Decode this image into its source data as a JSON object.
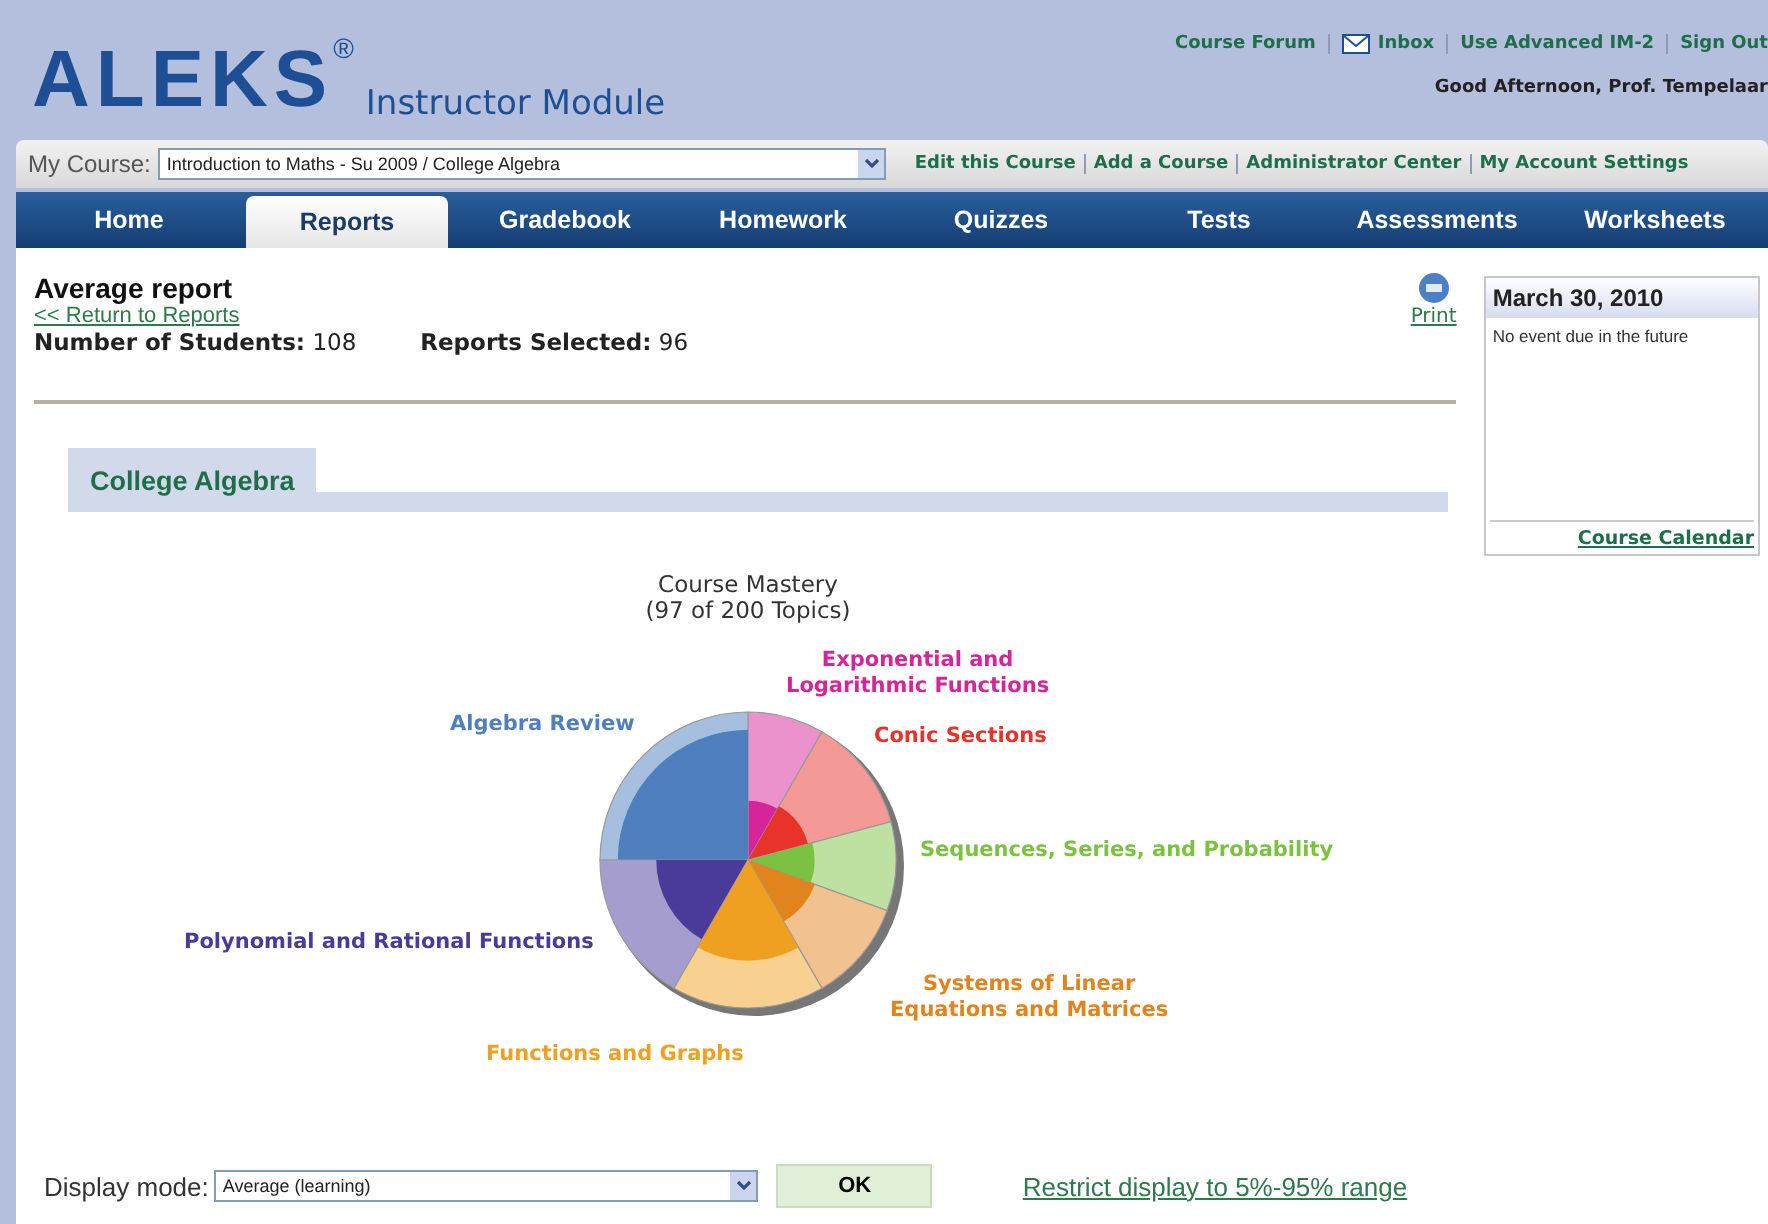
{
  "header": {
    "logo": "ALEKS",
    "logo_mark": "®",
    "subtitle": "Instructor Module",
    "links": [
      "Course Forum",
      "Inbox",
      "Use Advanced IM-2",
      "Sign Out"
    ],
    "greeting": "Good Afternoon, Prof. Tempelaar"
  },
  "course_bar": {
    "label": "My Course:",
    "value": "Introduction to Maths - Su 2009 / College Algebra",
    "links": [
      "Edit this Course",
      "Add a Course",
      "Administrator Center",
      "My Account Settings"
    ]
  },
  "tabs": [
    {
      "label": "Home",
      "selected": false
    },
    {
      "label": "Reports",
      "selected": true
    },
    {
      "label": "Gradebook",
      "selected": false
    },
    {
      "label": "Homework",
      "selected": false
    },
    {
      "label": "Quizzes",
      "selected": false
    },
    {
      "label": "Tests",
      "selected": false
    },
    {
      "label": "Assessments",
      "selected": false
    },
    {
      "label": "Worksheets",
      "selected": false
    }
  ],
  "report": {
    "title": "Average report",
    "back_link": "<< Return to Reports",
    "stats": [
      {
        "label": "Number of Students:",
        "value": "108"
      },
      {
        "label": "Reports Selected:",
        "value": "96"
      }
    ],
    "print": "Print",
    "section_tab": "College Algebra"
  },
  "chart": {
    "title": "Course Mastery",
    "subtitle": "(97 of 200 Topics)",
    "segments": [
      {
        "name": "Exponential and\nLogarithmic Functions",
        "color": "#d6249b"
      },
      {
        "name": "Algebra Review",
        "color": "#4f7fbf"
      },
      {
        "name": "Conic Sections",
        "color": "#e8332a"
      },
      {
        "name": "Sequences, Series, and Probability",
        "color": "#7cc242"
      },
      {
        "name": "Polynomial and Rational Functions",
        "color": "#4a3a9a"
      },
      {
        "name": "Systems of Linear\nEquations and Matrices",
        "color": "#e2841e"
      },
      {
        "name": "Functions and Graphs",
        "color": "#f0a020"
      }
    ]
  },
  "calendar": {
    "date": "March 30, 2010",
    "message": "No event due in the future",
    "link": "Course Calendar"
  },
  "footer": {
    "label": "Display mode:",
    "value": "Average (learning)",
    "ok": "OK",
    "link": "Restrict display to 5%-95% range"
  }
}
